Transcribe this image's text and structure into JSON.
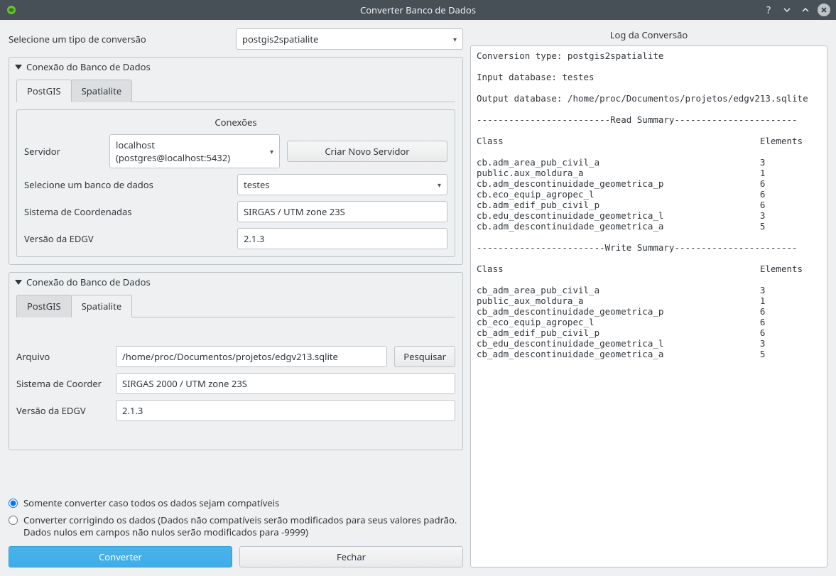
{
  "window": {
    "title": "Converter Banco de Dados"
  },
  "left": {
    "select_type_label": "Selecione um tipo de conversão",
    "type_value": "postgis2spatialite",
    "group1": {
      "title": "Conexão do Banco de Dados",
      "tabs": {
        "postgis": "PostGIS",
        "spatialite": "Spatialite"
      },
      "conn_title": "Conexões",
      "server_label": "Servidor",
      "server_value": "localhost (postgres@localhost:5432)",
      "new_server_btn": "Criar Novo Servidor",
      "db_label": "Selecione um banco de dados",
      "db_value": "testes",
      "crs_label": "Sistema de Coordenadas",
      "crs_value": "SIRGAS / UTM zone 23S",
      "edgv_label": "Versão da EDGV",
      "edgv_value": "2.1.3"
    },
    "group2": {
      "title": "Conexão do Banco de Dados",
      "tabs": {
        "postgis": "PostGIS",
        "spatialite": "Spatialite"
      },
      "file_label": "Arquivo",
      "file_value": "/home/proc/Documentos/projetos/edgv213.sqlite",
      "browse_btn": "Pesquisar",
      "crs_label": "Sistema de Coorder",
      "crs_value": "SIRGAS 2000 / UTM zone 23S",
      "edgv_label": "Versão da EDGV",
      "edgv_value": "2.1.3"
    },
    "radio1": "Somente converter caso todos os dados sejam compatíveis",
    "radio2": "Converter corrigindo os dados (Dados não compatíveis serão modificados para seus valores padrão. Dados nulos em campos não nulos serão modificados para -9999)",
    "convert_btn": "Converter",
    "close_btn": "Fechar"
  },
  "right": {
    "title": "Log da Conversão",
    "log": "Conversion type: postgis2spatialite\n\nInput database: testes\n\nOutput database: /home/proc/Documentos/projetos/edgv213.sqlite\n\n-------------------------Read Summary-----------------------\n\nClass                                                Elements\n\ncb.adm_area_pub_civil_a                              3\npublic.aux_moldura_a                                 1\ncb.adm_descontinuidade_geometrica_p                  6\ncb.eco_equip_agropec_l                               6\ncb.adm_edif_pub_civil_p                              6\ncb.edu_descontinuidade_geometrica_l                  3\ncb.adm_descontinuidade_geometrica_a                  5\n\n------------------------Write Summary-----------------------\n\nClass                                                Elements\n\ncb_adm_area_pub_civil_a                              3\npublic_aux_moldura_a                                 1\ncb_adm_descontinuidade_geometrica_p                  6\ncb_eco_equip_agropec_l                               6\ncb_adm_edif_pub_civil_p                              6\ncb_edu_descontinuidade_geometrica_l                  3\ncb_adm_descontinuidade_geometrica_a                  5"
  }
}
